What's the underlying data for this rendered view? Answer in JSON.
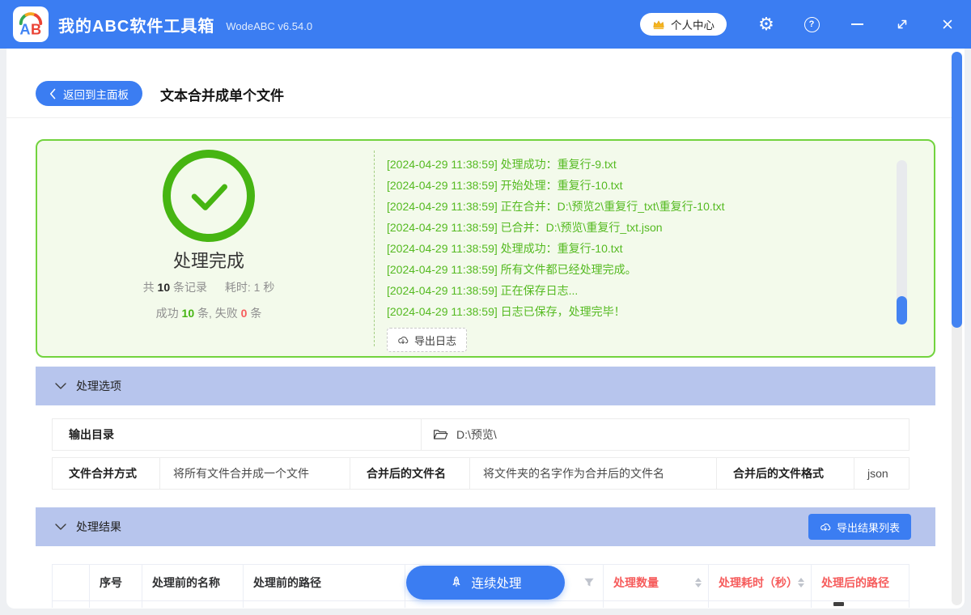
{
  "colors": {
    "accent_blue": "#3b7df2",
    "green": "#46b512",
    "green_log": "#55ba21",
    "red": "#f65c5c",
    "section_lavender": "#b7c5ed",
    "scroll_blue": "#4383f2"
  },
  "titlebar": {
    "logo_text": "AB",
    "app_name": "我的ABC软件工具箱",
    "version": "WodeABC v6.54.0",
    "user_center": "个人中心"
  },
  "header": {
    "back": "返回到主面板",
    "title": "文本合并成单个文件"
  },
  "result_panel": {
    "status": "处理完成",
    "total_prefix": "共",
    "total_count": "10",
    "total_suffix": "条记录",
    "elapsed": "耗时: 1 秒",
    "success_prefix": "成功",
    "success_count": "10",
    "success_suffix": "条,",
    "fail_prefix": "失败",
    "fail_count": "0",
    "fail_suffix": "条",
    "logs": [
      "[2024-04-29 11:38:59] 处理成功：重复行-9.txt",
      "[2024-04-29 11:38:59] 开始处理：重复行-10.txt",
      "[2024-04-29 11:38:59] 正在合并：D:\\预览2\\重复行_txt\\重复行-10.txt",
      "[2024-04-29 11:38:59] 已合并：D:\\预览\\重复行_txt.json",
      "[2024-04-29 11:38:59] 处理成功：重复行-10.txt",
      "[2024-04-29 11:38:59] 所有文件都已经处理完成。",
      "[2024-04-29 11:38:59] 正在保存日志...",
      "[2024-04-29 11:38:59] 日志已保存，处理完毕！"
    ],
    "export_log": "导出日志"
  },
  "options": {
    "title": "处理选项",
    "output_dir_label": "输出目录",
    "output_dir_value": "D:\\预览\\",
    "merge_mode_label": "文件合并方式",
    "merge_mode_value": "将所有文件合并成一个文件",
    "file_name_label": "合并后的文件名",
    "file_name_value": "将文件夹的名字作为合并后的文件名",
    "format_label": "合并后的文件格式",
    "format_value": "json"
  },
  "results": {
    "title": "处理结果",
    "export_list": "导出结果列表",
    "continue": "连续处理",
    "col_index": "序号",
    "col_name_before": "处理前的名称",
    "col_path_before": "处理前的路径",
    "col_count": "处理数量",
    "col_elapsed": "处理耗时（秒）",
    "col_path_after": "处理后的路径"
  }
}
